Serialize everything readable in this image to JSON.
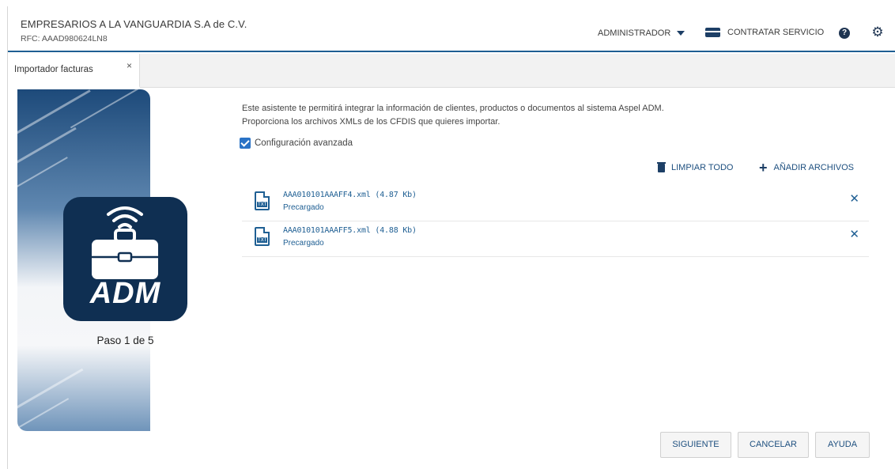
{
  "header": {
    "company": "EMPRESARIOS A LA VANGUARDIA S.A de C.V.",
    "rfc": "RFC: AAAD980624LN8",
    "user_menu_label": "ADMINISTRADOR",
    "contract_label": "CONTRATAR SERVICIO",
    "help_icon": "question-circle-icon",
    "settings_icon": "gear-icon"
  },
  "tabs": [
    {
      "label": "Importador facturas",
      "close": "×"
    }
  ],
  "sidebar": {
    "logo_text": "ADM",
    "step": "Paso 1 de 5"
  },
  "main": {
    "intro_line1": "Este asistente te permitirá integrar la información de clientes, productos o documentos al sistema Aspel ADM.",
    "intro_line2": "Proporciona los archivos XMLs de los CFDIS que quieres importar.",
    "advanced_label": "Configuración avanzada",
    "advanced_checked": true,
    "clear_all_label": "LIMPIAR TODO",
    "add_files_label": "AÑADIR ARCHIVOS",
    "files": [
      {
        "name": "AAA010101AAAFF4.xml (4.87 Kb)",
        "status": "Precargado",
        "badge": "TXT"
      },
      {
        "name": "AAA010101AAAFF5.xml (4.88 Kb)",
        "status": "Precargado",
        "badge": "TXT"
      }
    ]
  },
  "footer": {
    "next_label": "SIGUIENTE",
    "cancel_label": "CANCELAR",
    "help_label": "AYUDA"
  },
  "colors": {
    "brand_navy": "#0f2f52",
    "accent_blue": "#1f5f93",
    "checkbox_blue": "#2a73c6"
  }
}
